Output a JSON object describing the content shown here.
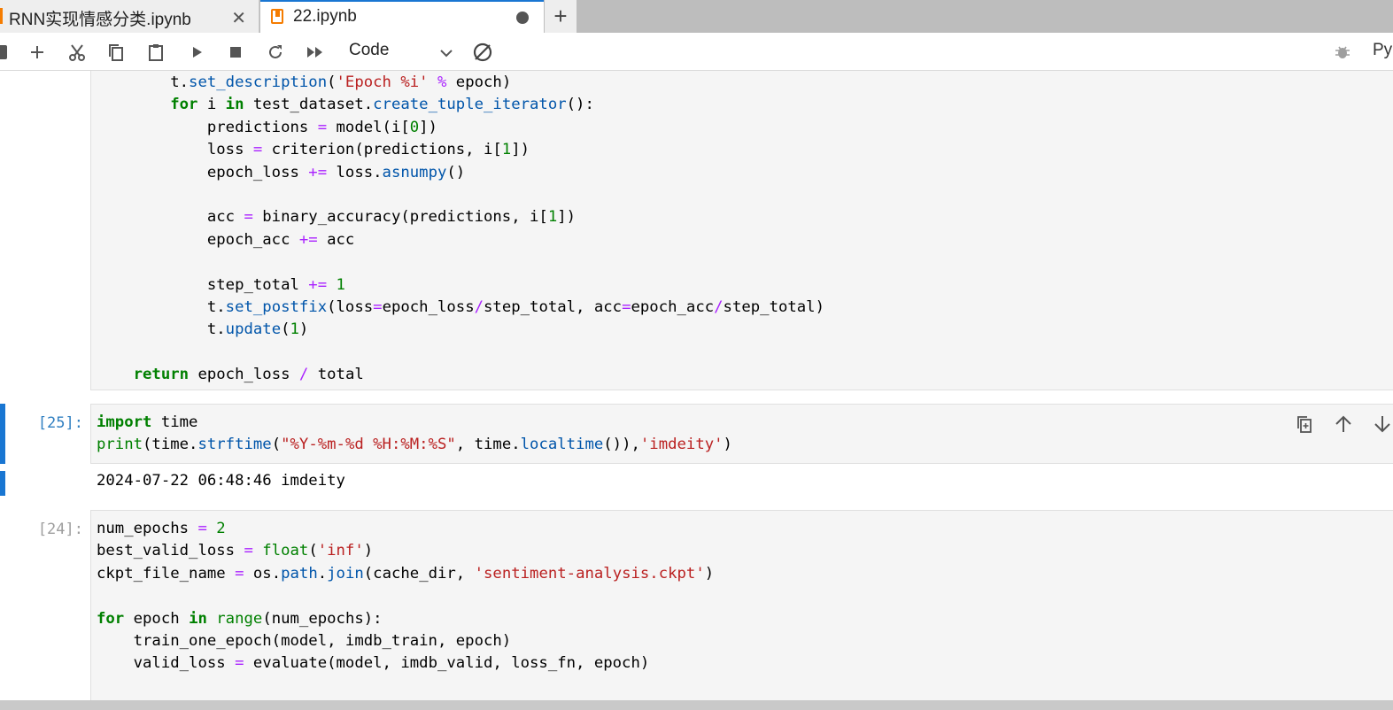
{
  "tabs": [
    {
      "label": "RNN实现情感分类.ipynb",
      "active": false
    },
    {
      "label": "22.ipynb",
      "active": true
    }
  ],
  "toolbar": {
    "cell_type": "Code",
    "kernel_name": "Py"
  },
  "cells": [
    {
      "prompt": "",
      "lines": [
        "        t.set_description('Epoch %i' % epoch)",
        "        for i in test_dataset.create_tuple_iterator():",
        "            predictions = model(i[0])",
        "            loss = criterion(predictions, i[1])",
        "            epoch_loss += loss.asnumpy()",
        "",
        "            acc = binary_accuracy(predictions, i[1])",
        "            epoch_acc += acc",
        "",
        "            step_total += 1",
        "            t.set_postfix(loss=epoch_loss/step_total, acc=epoch_acc/step_total)",
        "            t.update(1)",
        "",
        "    return epoch_loss / total"
      ]
    },
    {
      "prompt": "[25]:",
      "lines": [
        "import time",
        "print(time.strftime(\"%Y-%m-%d %H:%M:%S\", time.localtime()),'imdeity')"
      ],
      "output": "2024-07-22 06:48:46 imdeity"
    },
    {
      "prompt": "[24]:",
      "lines": [
        "num_epochs = 2",
        "best_valid_loss = float('inf')",
        "ckpt_file_name = os.path.join(cache_dir, 'sentiment-analysis.ckpt')",
        "",
        "for epoch in range(num_epochs):",
        "    train_one_epoch(model, imdb_train, epoch)",
        "    valid_loss = evaluate(model, imdb_valid, loss_fn, epoch)"
      ]
    }
  ],
  "colors": {
    "accent": "#1976d2",
    "keyword": "#008000",
    "operator": "#aa22ff",
    "string": "#ba2121",
    "attribute": "#0055aa"
  }
}
